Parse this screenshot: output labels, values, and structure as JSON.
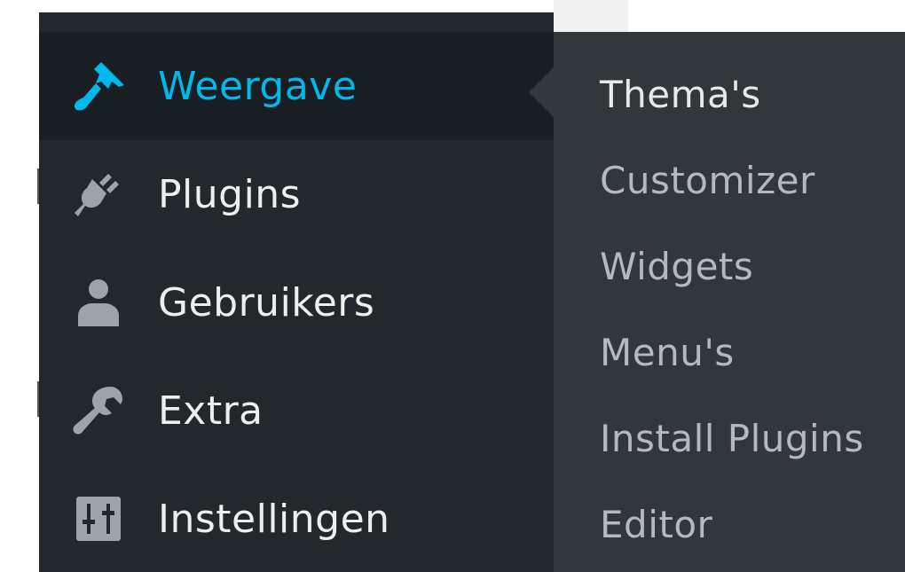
{
  "menu": {
    "items": [
      {
        "label": "Weergave",
        "icon": "paintbrush-icon",
        "current": true
      },
      {
        "label": "Plugins",
        "icon": "plugin-icon",
        "current": false
      },
      {
        "label": "Gebruikers",
        "icon": "users-icon",
        "current": false
      },
      {
        "label": "Extra",
        "icon": "wrench-icon",
        "current": false
      },
      {
        "label": "Instellingen",
        "icon": "settings-icon",
        "current": false
      }
    ]
  },
  "submenu": {
    "items": [
      {
        "label": "Thema's"
      },
      {
        "label": "Customizer"
      },
      {
        "label": "Widgets"
      },
      {
        "label": "Menu's"
      },
      {
        "label": "Install Plugins"
      },
      {
        "label": "Editor"
      }
    ]
  },
  "colors": {
    "menu_bg": "#23282d",
    "menu_current_bg": "#191e23",
    "submenu_bg": "#32373c",
    "accent": "#00b9eb",
    "menu_text": "#eeeeee",
    "submenu_text": "#b4b9be",
    "icon": "#9ea3a8"
  }
}
